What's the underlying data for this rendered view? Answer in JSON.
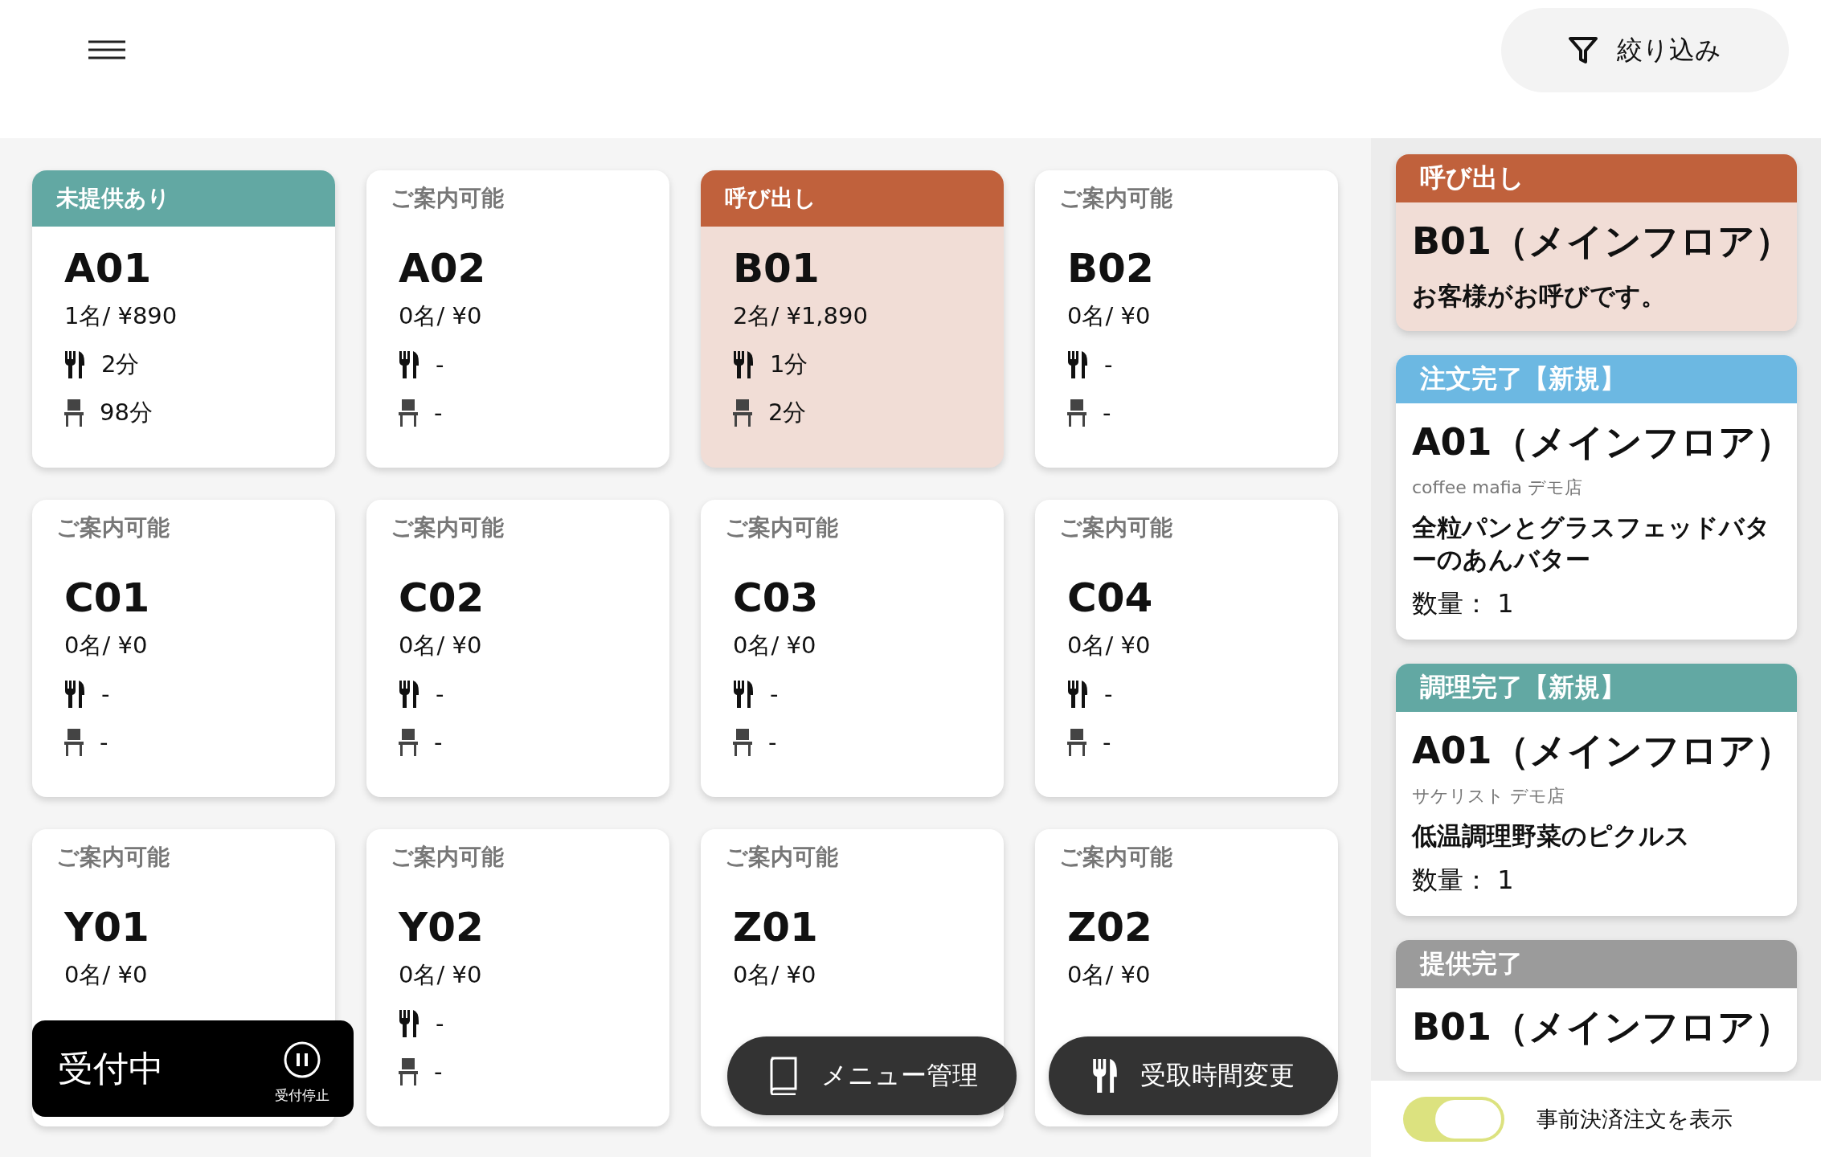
{
  "header": {
    "filter_button": "絞り込み"
  },
  "tables": [
    {
      "status": "未提供あり",
      "kind": "unserved",
      "name": "A01",
      "summary": "1名/ ¥890",
      "food_time": "2分",
      "seat_time": "98分"
    },
    {
      "status": "ご案内可能",
      "kind": "available",
      "name": "A02",
      "summary": "0名/ ¥0",
      "food_time": "-",
      "seat_time": "-"
    },
    {
      "status": "呼び出し",
      "kind": "call",
      "name": "B01",
      "summary": "2名/ ¥1,890",
      "food_time": "1分",
      "seat_time": "2分"
    },
    {
      "status": "ご案内可能",
      "kind": "available",
      "name": "B02",
      "summary": "0名/ ¥0",
      "food_time": "-",
      "seat_time": "-"
    },
    {
      "status": "ご案内可能",
      "kind": "available",
      "name": "C01",
      "summary": "0名/ ¥0",
      "food_time": "-",
      "seat_time": "-"
    },
    {
      "status": "ご案内可能",
      "kind": "available",
      "name": "C02",
      "summary": "0名/ ¥0",
      "food_time": "-",
      "seat_time": "-"
    },
    {
      "status": "ご案内可能",
      "kind": "available",
      "name": "C03",
      "summary": "0名/ ¥0",
      "food_time": "-",
      "seat_time": "-"
    },
    {
      "status": "ご案内可能",
      "kind": "available",
      "name": "C04",
      "summary": "0名/ ¥0",
      "food_time": "-",
      "seat_time": "-"
    },
    {
      "status": "ご案内可能",
      "kind": "available",
      "name": "Y01",
      "summary": "0名/ ¥0"
    },
    {
      "status": "ご案内可能",
      "kind": "available",
      "name": "Y02",
      "summary": "0名/ ¥0",
      "food_time": "-",
      "seat_time": "-"
    },
    {
      "status": "ご案内可能",
      "kind": "available",
      "name": "Z01",
      "summary": "0名/ ¥0"
    },
    {
      "status": "ご案内可能",
      "kind": "available",
      "name": "Z02",
      "summary": "0名/ ¥0"
    }
  ],
  "reception": {
    "label": "受付中",
    "pause_label": "受付停止"
  },
  "actions": [
    {
      "kind": "menu",
      "label": "メニュー管理"
    },
    {
      "kind": "time",
      "label": "受取時間変更"
    }
  ],
  "notifications": [
    {
      "kind": "call",
      "header": "呼び出し",
      "title": "B01（メインフロア）",
      "message": "お客様がお呼びです。"
    },
    {
      "kind": "order",
      "header": "注文完了【新規】",
      "title": "A01（メインフロア）",
      "shop": "coffee mafia デモ店",
      "item": "全粒パンとグラスフェッドバターのあんバター",
      "quantity": "数量： 1"
    },
    {
      "kind": "cooked",
      "header": "調理完了【新規】",
      "title": "A01（メインフロア）",
      "shop": "サケリスト デモ店",
      "item": "低温調理野菜のピクルス",
      "quantity": "数量： 1"
    },
    {
      "kind": "served",
      "header": "提供完了",
      "title": "B01（メインフロア）"
    }
  ],
  "prepaid_toggle": {
    "label": "事前決済注文を表示",
    "on": true
  }
}
